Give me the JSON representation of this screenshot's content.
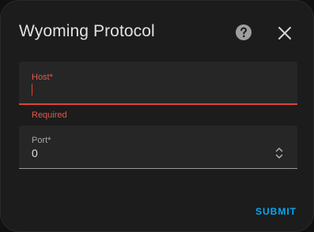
{
  "dialog": {
    "title": "Wyoming Protocol",
    "help_icon": "help-circle-icon",
    "close_icon": "close-icon"
  },
  "form": {
    "host": {
      "label": "Host*",
      "value": "",
      "error": "Required"
    },
    "port": {
      "label": "Port*",
      "value": "0",
      "stepper_icon": "up-down-chevron-icon"
    }
  },
  "actions": {
    "submit_label": "SUBMIT"
  },
  "colors": {
    "background": "#1c1c1c",
    "field_background": "#262626",
    "error": "#db4437",
    "accent": "#03a9f4",
    "text": "#e1e1e1"
  }
}
